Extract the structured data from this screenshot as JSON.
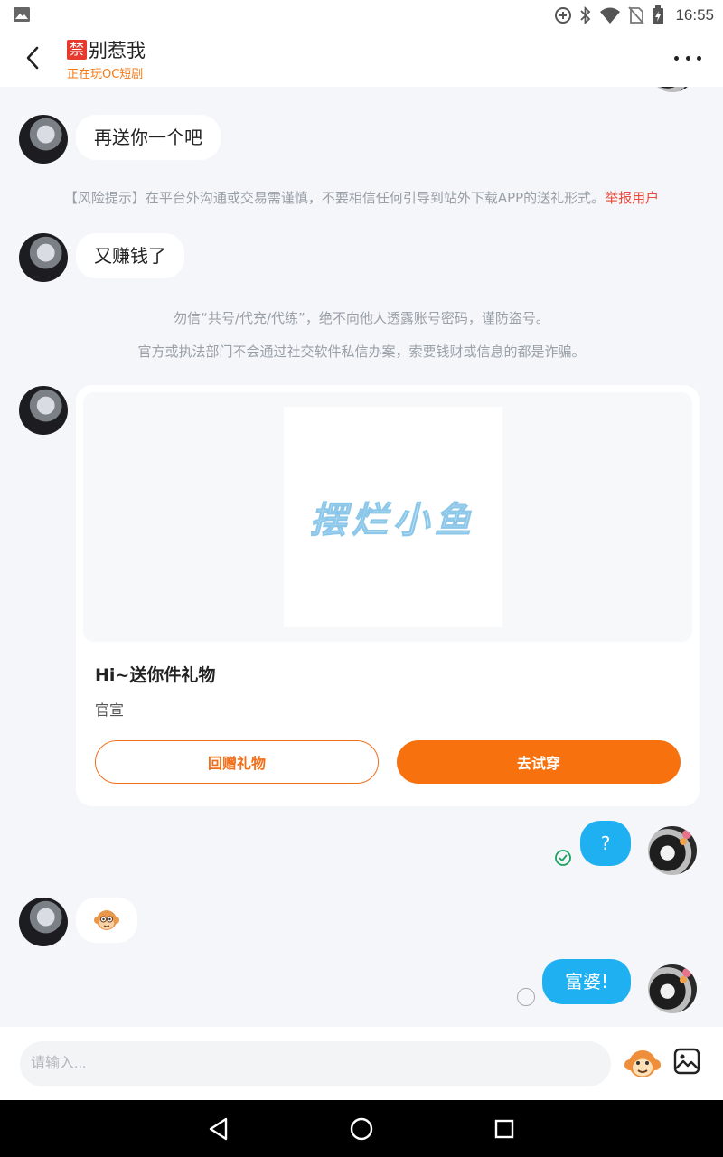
{
  "status_bar": {
    "time": "16:55"
  },
  "header": {
    "ban_badge": "禁",
    "title": "别惹我",
    "subtitle": "正在玩OC短剧"
  },
  "messages": {
    "m1_text": "再送你一个吧",
    "risk_notice": "【风险提示】在平台外沟通或交易需谨慎，不要相信任何引导到站外下载APP的送礼形式。",
    "risk_report": "举报用户",
    "m2_text": "又赚钱了",
    "safety_line1": "勿信“共号/代充/代练”，绝不向他人透露账号密码，谨防盗号。",
    "safety_line2": "官方或执法部门不会通过社交软件私信办案，索要钱财或信息的都是诈骗。",
    "m5_text": "?",
    "m7_text": "富婆!"
  },
  "gift_card": {
    "image_text": "摆烂小鱼",
    "title": "Hi~送你件礼物",
    "desc": "官宣",
    "return_label": "回赠礼物",
    "try_label": "去试穿"
  },
  "input": {
    "placeholder": "请输入..."
  },
  "colors": {
    "accent": "#f7720f",
    "bubble_me": "#1fb0f2",
    "report": "#e84a3b"
  },
  "icons": [
    "back-arrow-icon",
    "more-icon",
    "check-circle-icon",
    "monkey-emoji-icon",
    "image-icon",
    "nav-back-icon",
    "nav-home-icon",
    "nav-recents-icon"
  ]
}
